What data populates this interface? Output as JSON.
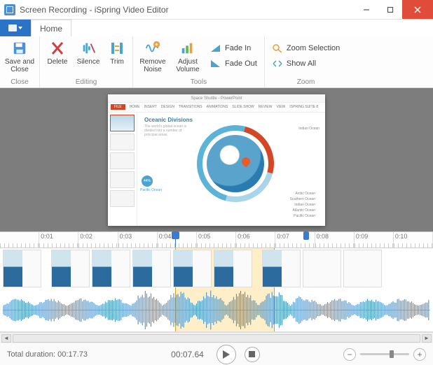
{
  "window": {
    "title": "Screen Recording - iSpring Video Editor"
  },
  "tabs": {
    "home": "Home"
  },
  "ribbon": {
    "close": {
      "label": "Close",
      "save": "Save and\nClose"
    },
    "editing": {
      "label": "Editing",
      "delete": "Delete",
      "silence": "Silence",
      "trim": "Trim"
    },
    "tools": {
      "label": "Tools",
      "remove_noise": "Remove\nNoise",
      "adjust_volume": "Adjust\nVolume",
      "fade_in": "Fade In",
      "fade_out": "Fade Out"
    },
    "zoom": {
      "label": "Zoom",
      "zoom_selection": "Zoom Selection",
      "show_all": "Show All"
    }
  },
  "preview": {
    "ppt_title": "Space Shuttle - PowerPoint",
    "ppt_tabs": [
      "FILE",
      "HOME",
      "INSERT",
      "DESIGN",
      "TRANSITIONS",
      "ANIMATIONS",
      "SLIDE SHOW",
      "REVIEW",
      "VIEW",
      "ISPRING SUITE 8"
    ],
    "slide_title": "Oceanic Divisions",
    "slide_sub": "The world's global ocean is divided into a number of principal areas",
    "badge_pct": "44%",
    "badge_label": "Pacific Ocean",
    "legend_right": "Indian Ocean",
    "legend_items": [
      "Arctic Ocean",
      "Southern Ocean",
      "Indian Ocean",
      "Atlantic Ocean",
      "Pacific Ocean"
    ]
  },
  "ruler": {
    "marks": [
      "0:01",
      "0:02",
      "0:03",
      "0:04",
      "0:05",
      "0:06",
      "0:07",
      "0:08",
      "0:09",
      "0:10"
    ]
  },
  "timeline": {
    "selection_start_pct": 40.5,
    "selection_end_pct": 63.5,
    "playhead_pct": 40.5,
    "end_handle_pct": 70
  },
  "footer": {
    "total_duration_label": "Total duration:",
    "total_duration": "00:17.73",
    "current_time": "00:07.64",
    "zoom_pos_pct": 60
  }
}
